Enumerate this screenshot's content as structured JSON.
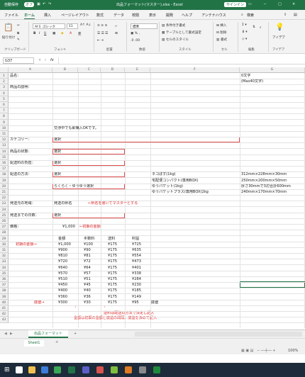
{
  "titlebar": {
    "autosave": "自動保存",
    "autosave_state": "オフ",
    "filename": "出品フォーマット(マスター).xlsx  -  Excel",
    "signin": "サインイン"
  },
  "tabs": [
    "ファイル",
    "ホーム",
    "挿入",
    "ページレイアウト",
    "数式",
    "データ",
    "校閲",
    "表示",
    "開発",
    "ヘルプ",
    "アンテナハウス"
  ],
  "search_label": "検索",
  "ribbon": {
    "paste": "貼り付け",
    "clipboard": "クリップボード",
    "font_name": "ＭＳ ゴシック",
    "font_size": "11",
    "font_group": "フォント",
    "align_group": "配置",
    "number_format": "標準",
    "number_group": "数値",
    "cond_format": "条件付き書式",
    "table_format": "テーブルとして書式設定",
    "cell_styles": "セルのスタイル",
    "style_group": "スタイル",
    "insert": "挿入",
    "delete": "削除",
    "format": "書式",
    "cells_group": "セル",
    "edit_group": "編集",
    "ideas": "アイデア",
    "ideas_group": "アイデア"
  },
  "formula_bar": {
    "name_box": "G37",
    "fx": "fx",
    "value": ""
  },
  "columns": [
    "A",
    "B",
    "C",
    "D",
    "E",
    "F",
    "G"
  ],
  "rows": [
    "1",
    "2",
    "3",
    "4",
    "5",
    "6",
    "7",
    "8",
    "9",
    "10",
    "11",
    "12",
    "13",
    "14",
    "15",
    "16",
    "17",
    "18",
    "19",
    "20",
    "21",
    "22",
    "23",
    "24",
    "25",
    "26",
    "27",
    "28",
    "29",
    "30",
    "31",
    "32",
    "33",
    "34",
    "35",
    "36",
    "37",
    "38",
    "39",
    "40",
    "41",
    "42",
    "43"
  ],
  "sheet": {
    "r1_label": "品名：",
    "g1": "0文字",
    "g2": "(Max40文字)",
    "r3_label": "商品の説明：",
    "r10_text": "交渉中でも即購入OKです。",
    "cat_label": "カテゴリー：",
    "cat_val": "選択",
    "cond_label": "商品の状態：",
    "cond_val": "選択",
    "fee_label": "配送料の負担：",
    "fee_val": "選択",
    "method_label": "配送の方法：",
    "method_val": "選択",
    "method_val2": "らくらく・ゆうゆう選択",
    "ship_list": [
      {
        "name": "ネコぽす(1kg)",
        "size": "312mm×228mm×30mm"
      },
      {
        "name": "宅配便コンパクト(専用BOX)",
        "size": "250mm×200mm×50mm"
      },
      {
        "name": "ゆうパケット(1kg)",
        "size": "厚さ30mmで3辺合計600mm"
      },
      {
        "name": "ゆうパケットプラス(専用BOX)2kg",
        "size": "240mm×170mm×70mm"
      }
    ],
    "origin_label": "発送元の地域：",
    "origin_val": "発送の県名",
    "origin_note": "←県名を書いてマスターとする",
    "days_label": "発送までの日数：",
    "days_val": "選択",
    "price_label": "価格：",
    "price_val": "¥1,000",
    "price_note": "←初期の金額",
    "hdr": [
      "金額",
      "手数料",
      "送料",
      "利益"
    ],
    "price_rows": [
      [
        "¥1,000",
        "¥100",
        "¥175",
        "¥725"
      ],
      [
        "¥900",
        "¥90",
        "¥175",
        "¥635"
      ],
      [
        "¥810",
        "¥81",
        "¥175",
        "¥554"
      ],
      [
        "¥720",
        "¥72",
        "¥175",
        "¥473"
      ],
      [
        "¥640",
        "¥64",
        "¥175",
        "¥401"
      ],
      [
        "¥570",
        "¥57",
        "¥175",
        "¥338"
      ],
      [
        "¥510",
        "¥51",
        "¥175",
        "¥284"
      ],
      [
        "¥450",
        "¥45",
        "¥175",
        "¥230"
      ],
      [
        "¥400",
        "¥40",
        "¥175",
        "¥185"
      ],
      [
        "¥360",
        "¥36",
        "¥175",
        "¥149"
      ],
      [
        "¥300",
        "¥30",
        "¥175",
        "¥95"
      ]
    ],
    "init_note": "初期の金額→",
    "min_note": "底値→",
    "min_tag": "底値",
    "note1": "送料は配送の方法で決定し記入",
    "note2": "金額は初期の金額と底値の間隔、底値を決めて記入"
  },
  "sheet_tabs": {
    "active": "出品フォーマット",
    "other": "Sheet1",
    "add": "+"
  },
  "status": {
    "zoom": "100%"
  }
}
